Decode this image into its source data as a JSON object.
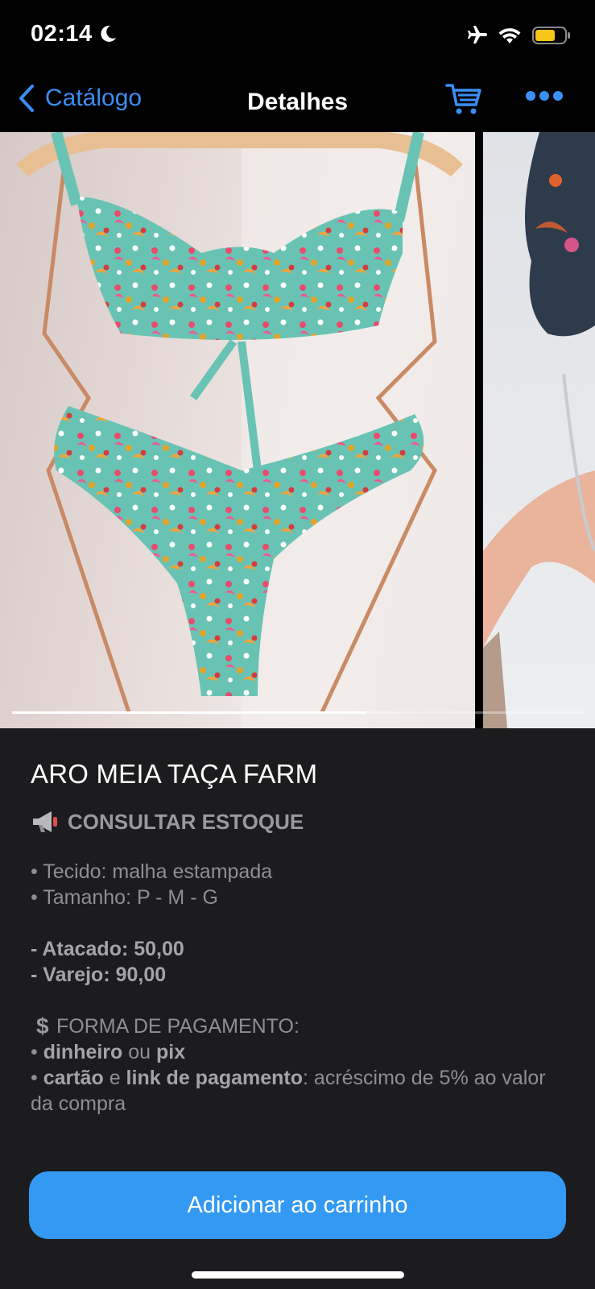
{
  "status_bar": {
    "time": "02:14"
  },
  "nav": {
    "back_label": "Catálogo",
    "title": "Detalhes"
  },
  "gallery": {
    "image_count": 2,
    "progress_fraction": 0.62
  },
  "product": {
    "title": "ARO MEIA TAÇA FARM",
    "stock_label": "CONSULTAR ESTOQUE",
    "fabric_line": "• Tecido: malha estampada",
    "size_line": "• Tamanho: P - M - G",
    "wholesale_line": "- Atacado: 50,00",
    "retail_line": "- Varejo: 90,00",
    "payment_header": "FORMA DE PAGAMENTO:",
    "pay1_bullet": "• ",
    "pay1_a": "dinheiro",
    "pay1_mid": " ou ",
    "pay1_b": "pix",
    "pay2_bullet": "• ",
    "pay2_a": "cartão",
    "pay2_mid": " e ",
    "pay2_b": "link de pagamento",
    "pay2_tail": ": acréscimo de 5% ao valor da compra"
  },
  "actions": {
    "add_to_cart": "Adicionar ao carrinho"
  },
  "colors": {
    "accent": "#3399f3",
    "link": "#3a8ff5",
    "battery": "#f5c518",
    "background": "#1c1c1e"
  },
  "icons": [
    "moon-icon",
    "airplane-icon",
    "wifi-icon",
    "battery-icon",
    "chevron-left-icon",
    "cart-icon",
    "more-icon",
    "megaphone-icon",
    "dollar-icon"
  ]
}
